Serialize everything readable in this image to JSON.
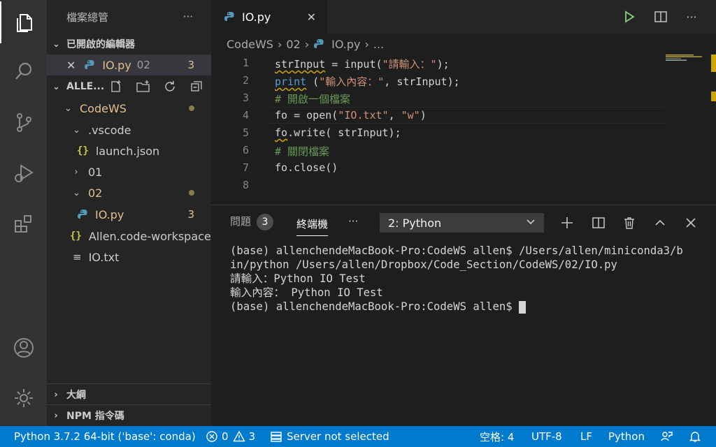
{
  "explorer": {
    "title": "檔案總管",
    "more": "···",
    "open_editors": {
      "label": "已開啟的編輯器",
      "items": [
        {
          "name": "IO.py",
          "folder": "02",
          "problems": "3"
        }
      ]
    },
    "workspace": {
      "label": "ALLE...",
      "tree": [
        {
          "name": "CodeWS"
        },
        {
          "name": ".vscode"
        },
        {
          "name": "launch.json"
        },
        {
          "name": "01"
        },
        {
          "name": "02"
        },
        {
          "name": "IO.py",
          "problems": "3"
        },
        {
          "name": "Allen.code-workspace"
        },
        {
          "name": "IO.txt"
        }
      ]
    },
    "outline_label": "大綱",
    "npm_label": "NPM 指令碼"
  },
  "editor": {
    "tab_label": "IO.py",
    "breadcrumb": [
      "CodeWS",
      "02",
      "IO.py",
      "..."
    ],
    "line_numbers": [
      "1",
      "2",
      "3",
      "4",
      "5",
      "6",
      "7",
      "8"
    ],
    "code": {
      "l1_a": "strInput",
      "l1_b": " = input(",
      "l1_s": "\"請輸入：\"",
      "l1_c": ");",
      "l2_a": "print",
      "l2_b": " (",
      "l2_s": "\"輸入內容：\"",
      "l2_c": ", strInput);",
      "l3": "# 開啟一個檔案",
      "l4_a": "fo = open(",
      "l4_s1": "\"IO.txt\"",
      "l4_b": ", ",
      "l4_s2": "\"w\"",
      "l4_c": ")",
      "l5_a": "fo",
      "l5_b": ".write( strInput);",
      "l6": "# 關閉檔案",
      "l7": "fo.close()"
    }
  },
  "panel": {
    "problems_label": "問題",
    "problems_count": "3",
    "terminal_label": "終端機",
    "more": "···",
    "terminal_select": "2: Python",
    "terminal_lines": [
      "(base) allenchendeMacBook-Pro:CodeWS allen$ /Users/allen/miniconda3/b",
      "in/python /Users/allen/Dropbox/Code_Section/CodeWS/02/IO.py",
      "請輸入：Python IO Test",
      "輸入內容： Python IO Test",
      "(base) allenchendeMacBook-Pro:CodeWS allen$ "
    ]
  },
  "statusbar": {
    "interpreter": "Python 3.7.2 64-bit ('base': conda)",
    "errors": "0",
    "warnings": "3",
    "server": "Server not selected",
    "spaces": "空格: 4",
    "encoding": "UTF-8",
    "eol": "LF",
    "language": "Python"
  },
  "colors": {
    "statusbar": "#007acc",
    "activitybar": "#333333",
    "sidebar": "#252526",
    "editor": "#1e1e1e",
    "modified": "#e2c08d"
  }
}
